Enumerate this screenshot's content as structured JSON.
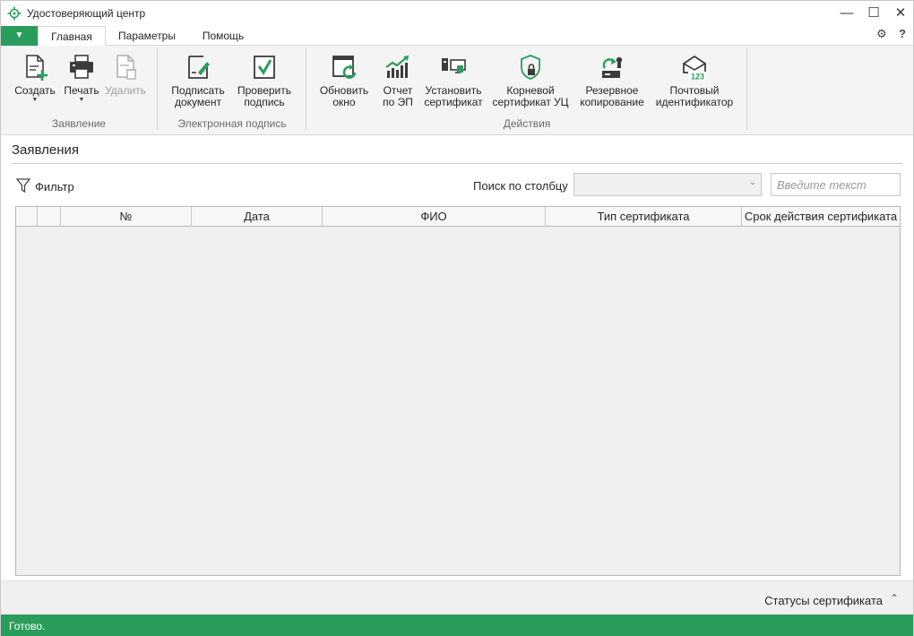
{
  "window": {
    "title": "Удостоверяющий центр",
    "minimize_glyph": "—",
    "maximize_glyph": "☐",
    "close_glyph": "✕"
  },
  "tabs": {
    "file_glyph": "▼",
    "items": [
      "Главная",
      "Параметры",
      "Помощь"
    ],
    "active": "Главная",
    "settings_glyph": "⚙",
    "help_glyph": "?"
  },
  "ribbon": {
    "groups": [
      {
        "label": "Заявление"
      },
      {
        "label": "Электронная подпись"
      },
      {
        "label": "Действия"
      }
    ],
    "buttons": {
      "create": {
        "line1": "Создать",
        "line2": "",
        "icon": "document-add-icon"
      },
      "print": {
        "line1": "Печать",
        "line2": "",
        "icon": "printer-icon"
      },
      "delete": {
        "line1": "Удалить",
        "line2": "",
        "icon": "document-delete-icon"
      },
      "sign": {
        "line1": "Подписать",
        "line2": "документ",
        "icon": "sign-document-icon"
      },
      "verify": {
        "line1": "Проверить",
        "line2": "подпись",
        "icon": "verify-signature-icon"
      },
      "refresh": {
        "line1": "Обновить",
        "line2": "окно",
        "icon": "refresh-window-icon"
      },
      "report": {
        "line1": "Отчет",
        "line2": "по ЭП",
        "icon": "report-chart-icon"
      },
      "install": {
        "line1": "Установить",
        "line2": "сертификат",
        "icon": "install-certificate-icon"
      },
      "root": {
        "line1": "Корневой",
        "line2": "сертификат УЦ",
        "icon": "root-certificate-icon"
      },
      "backup": {
        "line1": "Резервное",
        "line2": "копирование",
        "icon": "backup-icon"
      },
      "mailid": {
        "line1": "Почтовый",
        "line2": "идентификатор",
        "icon": "mail-identifier-icon"
      }
    },
    "dropdown_glyph": "▼"
  },
  "content": {
    "section_title": "Заявления",
    "filter_label": "Фильтр",
    "search_label": "Поиск по столбцу",
    "search_placeholder": "Введите текст",
    "combo_value": "",
    "columns": [
      "",
      "",
      "№",
      "Дата",
      "ФИО",
      "Тип сертификата",
      "Срок действия сертификата"
    ],
    "rows": []
  },
  "bottom": {
    "statuses_label": "Статусы сертификата",
    "chevron_glyph": "⌃"
  },
  "statusbar": {
    "text": "Готово."
  },
  "colors": {
    "accent": "#2a9d5c",
    "icon_dark": "#3b3b3b",
    "icon_green": "#2a9d5c"
  }
}
